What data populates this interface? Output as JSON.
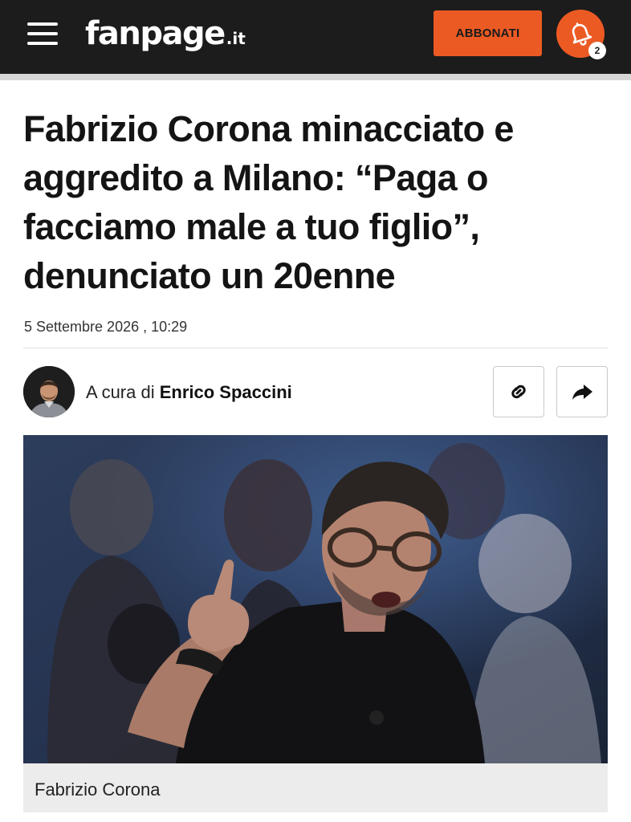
{
  "header": {
    "logo_main": "fanpage",
    "logo_tld": ".it",
    "subscribe_label": "ABBONATI",
    "notification_count": "2",
    "menu_icon": "hamburger-menu-icon",
    "bell_icon": "bell-icon",
    "colors": {
      "bar": "#1c1c1c",
      "accent": "#ec5a24"
    }
  },
  "article": {
    "title": "Fabrizio Corona minacciato e aggredito a Milano: “Paga o facciamo male a tuo figlio”, denunciato un 20enne",
    "date": "5 Settembre 2026 , 10:29",
    "byline_prefix": "A cura di ",
    "author": "Enrico Spaccini",
    "image_caption": "Fabrizio Corona"
  },
  "actions": {
    "copy_link_icon": "link-icon",
    "share_icon": "share-arrow-icon"
  }
}
